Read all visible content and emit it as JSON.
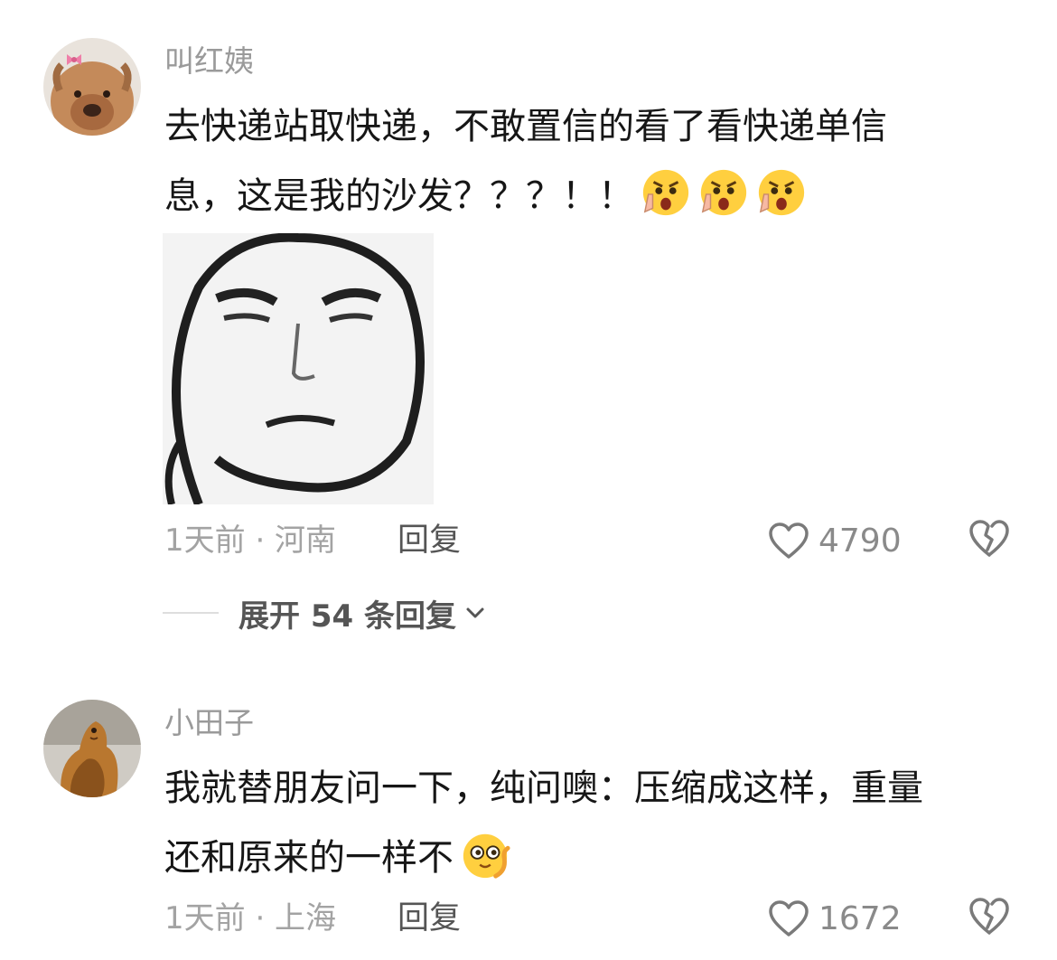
{
  "comments": [
    {
      "username": "叫红姨",
      "text_lines": [
        "去快递站取快递，不敢置信的看了看快递单信",
        "息，这是我的沙发？？？！！"
      ],
      "emojis": [
        "shocked-stop-emoji",
        "shocked-stop-emoji",
        "shocked-stop-emoji"
      ],
      "time_location": "1天前 · 河南",
      "reply_label": "回复",
      "like_count": "4790",
      "has_sticker": true
    },
    {
      "username": "小田子",
      "text_lines": [
        "我就替朋友问一下，纯问噢：压缩成这样，重量",
        "还和原来的一样不"
      ],
      "emojis": [
        "curious-emoji"
      ],
      "time_location": "1天前 · 上海",
      "reply_label": "回复",
      "like_count": "1672",
      "has_sticker": false
    }
  ],
  "expand_replies": {
    "label": "展开 54 条回复"
  },
  "colors": {
    "username": "#9a9a9a",
    "text": "#161616",
    "meta": "#a3a3a3",
    "icon": "#7a7a7a"
  },
  "icons": [
    "heart-icon",
    "broken-heart-icon",
    "chevron-down-icon"
  ]
}
